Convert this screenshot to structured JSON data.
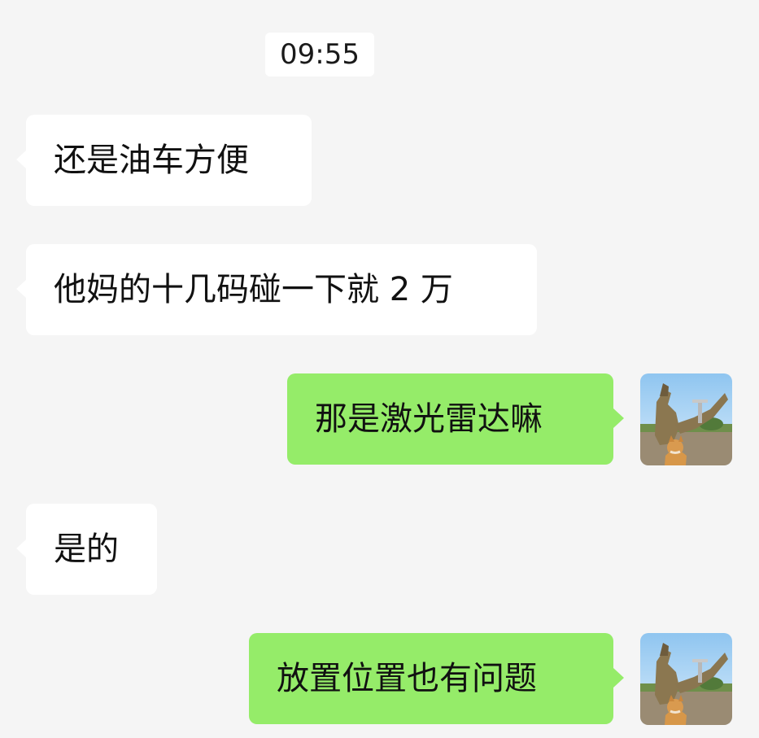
{
  "chat": {
    "timestamp": "09:55",
    "messages": [
      {
        "side": "left",
        "text": "还是油车方便"
      },
      {
        "side": "left",
        "text": "他妈的十几码碰一下就 2 万"
      },
      {
        "side": "right",
        "text": "那是激光雷达嘛"
      },
      {
        "side": "left",
        "text": "是的"
      },
      {
        "side": "right",
        "text": "放置位置也有问题"
      }
    ]
  },
  "colors": {
    "background": "#f5f5f5",
    "incoming_bubble": "#ffffff",
    "outgoing_bubble": "#95ec69"
  },
  "icons": {
    "avatar": "user-avatar-image"
  }
}
